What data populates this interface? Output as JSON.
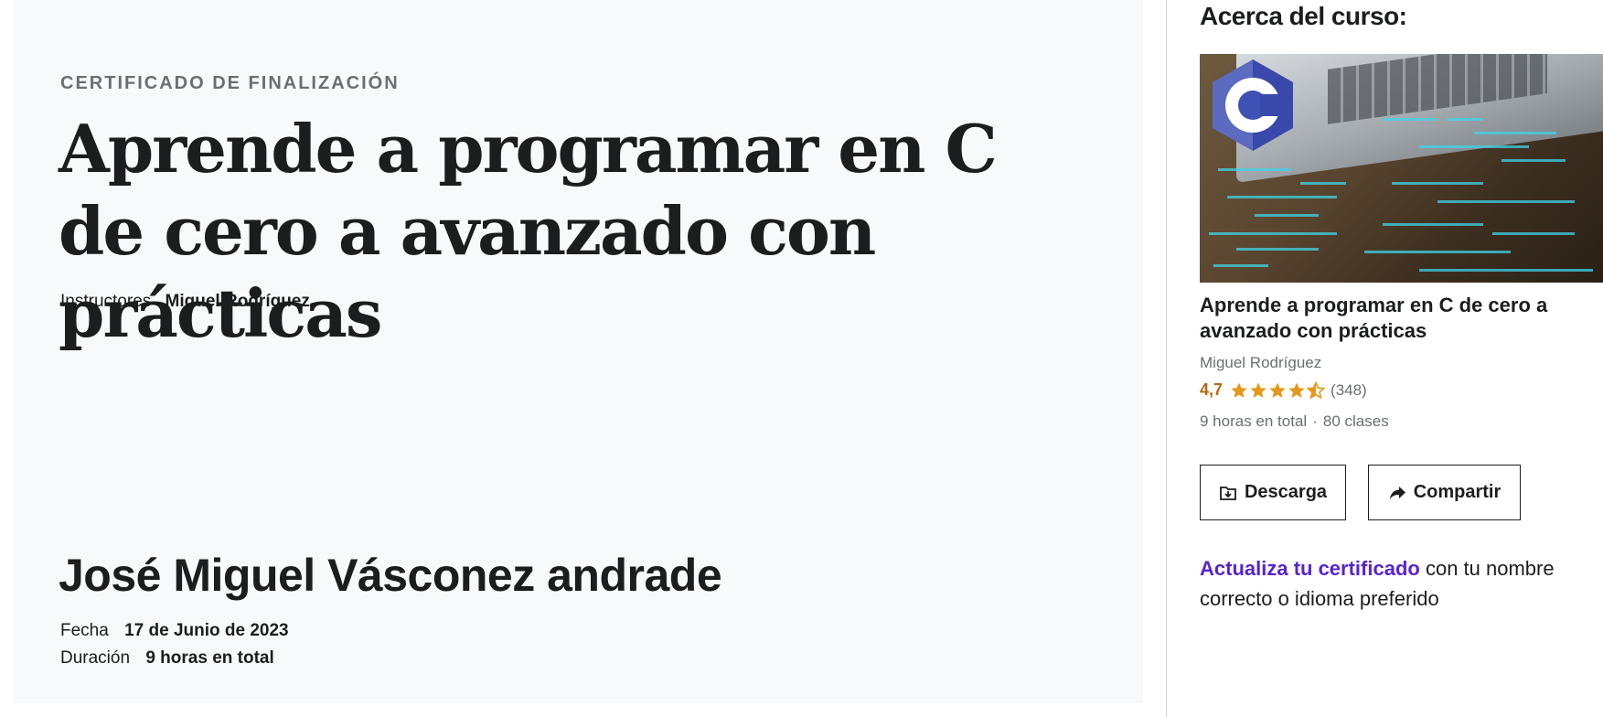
{
  "certificate": {
    "label": "CERTIFICADO DE FINALIZACIÓN",
    "title": "Aprende a programar en C de cero a avanzado con prácticas",
    "instructors_label": "Instructores",
    "instructors_value": "Miguel Rodríguez",
    "student_name": "José Miguel Vásconez andrade",
    "date_label": "Fecha",
    "date_value": "17 de Junio de 2023",
    "duration_label": "Duración",
    "duration_value": "9 horas en total"
  },
  "sidebar": {
    "heading": "Acerca del curso:",
    "thumbnail_icon": "c-language-logo",
    "course_title": "Aprende a programar en C de cero a avanzado con prácticas",
    "author": "Miguel Rodríguez",
    "rating": "4,7",
    "rating_stars": 4.5,
    "rating_count": "(348)",
    "hours": "9 horas en total",
    "separator": "·",
    "lectures": "80 clases",
    "download_label": "Descarga",
    "download_icon": "folder-download-icon",
    "share_label": "Compartir",
    "share_icon": "share-arrow-icon",
    "upgrade_link": "Actualiza tu certificado",
    "upgrade_text": " con tu nombre correcto o idioma preferido"
  },
  "colors": {
    "rating": "#b4690e",
    "star": "#e59819",
    "link": "#5624d0",
    "panel_bg": "#f7f9fa"
  }
}
